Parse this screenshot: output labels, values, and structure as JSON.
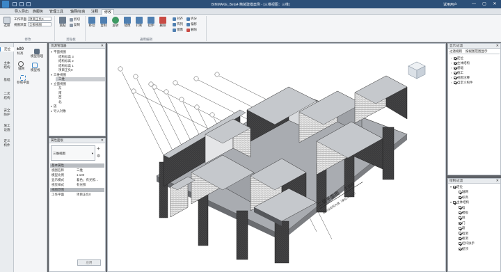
{
  "app": {
    "title": "BIMMAKE_Beta4 精装建模案例 - [三维视图：三维]",
    "user": "试用用户",
    "window_controls": [
      "—",
      "▢",
      "✕"
    ]
  },
  "menus": [
    "导入导出",
    "族服务",
    "管理工具",
    "轴网/标高",
    "注释",
    "修改"
  ],
  "menus_active_index": 5,
  "ribbon": {
    "workplane_label": "工作平面",
    "workplane_value": "项目正负0",
    "view_depth_label": "视图深度",
    "view_depth_value": "全部视图",
    "large_buttons": [
      "粘贴",
      "移动",
      "复制",
      "旋转",
      "镜像",
      "打断",
      "拉伸",
      "删除"
    ],
    "small_buttons": [
      "剪切",
      "复制",
      "对齐",
      "阵列",
      "镜像",
      "拆分",
      "偏移",
      "删除"
    ],
    "groups": [
      "修改",
      "剪贴板",
      "通用编辑"
    ],
    "select_label": "选择"
  },
  "leftbar": {
    "items": [
      "定位",
      "主体结构",
      "基础",
      "二次结构",
      "安全防护",
      "施工设施",
      "定义构件"
    ]
  },
  "toolpanel": {
    "items": [
      "标高",
      "模型管理",
      "轴网",
      "模型线",
      "参照平面"
    ]
  },
  "project_browser": {
    "title": "资源管理器",
    "rows": [
      {
        "toggle": "▾",
        "indent": 0,
        "label": "平面视图"
      },
      {
        "toggle": "",
        "indent": 1,
        "label": "结构标高 3"
      },
      {
        "toggle": "",
        "indent": 1,
        "label": "结构标高 2"
      },
      {
        "toggle": "",
        "indent": 1,
        "label": "结构标高 1"
      },
      {
        "toggle": "",
        "indent": 1,
        "label": "项目正负0"
      },
      {
        "toggle": "▾",
        "indent": 0,
        "label": "三维视图"
      },
      {
        "toggle": "",
        "indent": 1,
        "label": "三维",
        "selected": true
      },
      {
        "toggle": "▾",
        "indent": 0,
        "label": "立面视图"
      },
      {
        "toggle": "",
        "indent": 1,
        "label": "东"
      },
      {
        "toggle": "",
        "indent": 1,
        "label": "南"
      },
      {
        "toggle": "",
        "indent": 1,
        "label": "西"
      },
      {
        "toggle": "",
        "indent": 1,
        "label": "北"
      },
      {
        "toggle": "▸",
        "indent": 0,
        "label": "族"
      },
      {
        "toggle": "▸",
        "indent": 0,
        "label": "导入对象"
      }
    ]
  },
  "properties": {
    "title": "属性面板",
    "type_selector": "三维视图",
    "rows": [
      {
        "header": true,
        "k": "基本属性",
        "v": ""
      },
      {
        "k": "视图名称",
        "v": "三维"
      },
      {
        "k": "模型比例",
        "v": "1:100"
      },
      {
        "k": "显示模式",
        "v": "着色；有光照…"
      },
      {
        "k": "视觉样式",
        "v": "有光照"
      },
      {
        "header": true,
        "k": "视图范围",
        "v": ""
      },
      {
        "k": "工作平面",
        "v": "项目正负0"
      }
    ],
    "apply_label": "应用"
  },
  "display_filter": {
    "title": "显示/过滤",
    "tabs": [
      "过滤规则",
      "按视图范围显示"
    ],
    "rows": [
      {
        "indent": 0,
        "label": "定位",
        "checked": true
      },
      {
        "indent": 0,
        "label": "主体结构",
        "checked": true
      },
      {
        "indent": 0,
        "label": "基础",
        "checked": true
      },
      {
        "indent": 0,
        "label": "施工",
        "checked": true
      },
      {
        "indent": 0,
        "label": "视图注释",
        "checked": true
      },
      {
        "indent": 0,
        "label": "自定义构件",
        "checked": true
      }
    ]
  },
  "visibility": {
    "title": "绘制/过滤",
    "rows": [
      {
        "toggle": "▾",
        "indent": 0,
        "label": "定位",
        "checked": true
      },
      {
        "toggle": "",
        "indent": 1,
        "label": "轴网",
        "checked": true
      },
      {
        "toggle": "",
        "indent": 1,
        "label": "标高",
        "checked": true
      },
      {
        "toggle": "▾",
        "indent": 0,
        "label": "主体结构",
        "checked": true
      },
      {
        "toggle": "",
        "indent": 1,
        "label": "墙",
        "checked": true
      },
      {
        "toggle": "",
        "indent": 1,
        "label": "楼板",
        "checked": true
      },
      {
        "toggle": "",
        "indent": 1,
        "label": "柱",
        "checked": true
      },
      {
        "toggle": "",
        "indent": 1,
        "label": "门",
        "checked": true
      },
      {
        "toggle": "",
        "indent": 1,
        "label": "窗",
        "checked": true
      },
      {
        "toggle": "",
        "indent": 1,
        "label": "墙洞",
        "checked": true
      },
      {
        "toggle": "",
        "indent": 1,
        "label": "板洞",
        "checked": true
      },
      {
        "toggle": "",
        "indent": 1,
        "label": "栏杆扶手",
        "checked": true
      },
      {
        "toggle": "",
        "indent": 1,
        "label": "屋顶",
        "checked": true
      }
    ]
  },
  "viewport": {
    "annotation_title": "二层平面图",
    "annotation_scale": "1:100",
    "annotation_sub": "面积以实际为准（单位:平方米）",
    "grid_labels": [
      "①",
      "②",
      "③",
      "④",
      "⑤",
      "⑥",
      "⑦",
      "⑧",
      "⑨",
      "⑩",
      "⑪",
      "⑫",
      "Ⓐ",
      "Ⓑ",
      "Ⓒ",
      "Ⓓ",
      "Ⓔ"
    ]
  },
  "colors": {
    "accent": "#3b86c8",
    "title_bar": "#2c4f78",
    "wall_top": "#c5c8cc",
    "wall_dark": "#3a3a3c"
  }
}
